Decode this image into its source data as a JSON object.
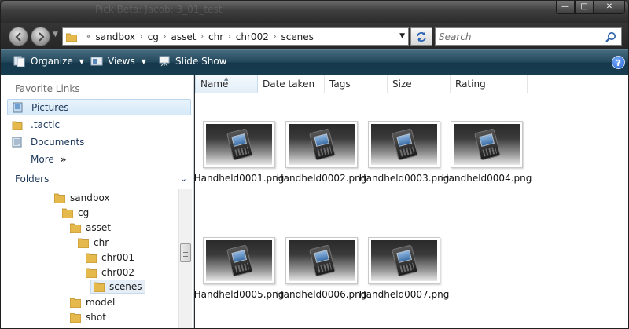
{
  "window": {
    "ghost_title": "Pick Beta: Jacob: 3_01_test",
    "minimize_glyph": "—",
    "maximize_glyph": "□",
    "close_glyph": "✕"
  },
  "address_bar": {
    "overflow_glyph": "«",
    "crumbs": [
      "sandbox",
      "cg",
      "asset",
      "chr",
      "chr002",
      "scenes"
    ],
    "separator_glyph": "›"
  },
  "search": {
    "placeholder": "Search"
  },
  "command_bar": {
    "organize_label": "Organize",
    "views_label": "Views",
    "slideshow_label": "Slide Show",
    "help_glyph": "?"
  },
  "nav_pane": {
    "favorite_links_header": "Favorite Links",
    "favorites": [
      {
        "label": "Pictures",
        "icon": "pictures-icon"
      },
      {
        "label": ".tactic",
        "icon": "folder-icon"
      },
      {
        "label": "Documents",
        "icon": "documents-icon"
      },
      {
        "label": "More",
        "icon": "more-chevron-icon"
      }
    ],
    "more_glyph": "»",
    "folders_header": "Folders",
    "folders_chevron": "⌄",
    "tree": [
      {
        "label": "sandbox",
        "level": 0
      },
      {
        "label": "cg",
        "level": 1
      },
      {
        "label": "asset",
        "level": 2
      },
      {
        "label": "chr",
        "level": 3
      },
      {
        "label": "chr001",
        "level": 4
      },
      {
        "label": "chr002",
        "level": 4
      },
      {
        "label": "scenes",
        "level": 5
      },
      {
        "label": "model",
        "level": 2
      },
      {
        "label": "shot",
        "level": 2
      }
    ]
  },
  "columns": [
    "Name",
    "Date taken",
    "Tags",
    "Size",
    "Rating"
  ],
  "files": [
    "Handheld0001.png",
    "Handheld0002.png",
    "Handheld0003.png",
    "Handheld0004.png",
    "Handheld0005.png",
    "Handheld0006.png",
    "Handheld0007.png"
  ],
  "colors": {
    "command_bar": "#23485c",
    "selection": "#d6e9f8",
    "link_text": "#1e395b"
  }
}
